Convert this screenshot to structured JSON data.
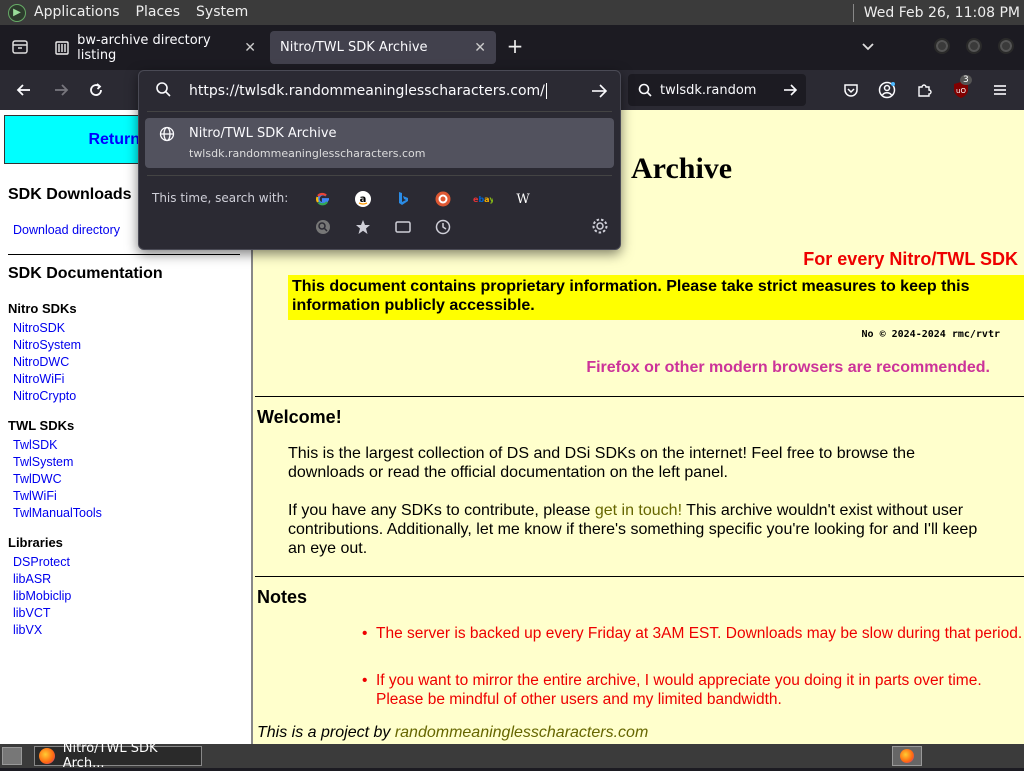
{
  "desktop": {
    "menu": [
      "Applications",
      "Places",
      "System"
    ],
    "clock": "Wed Feb 26, 11:08 PM"
  },
  "tabs": [
    {
      "title": "bw-archive directory listing",
      "icon": "folder-icon"
    },
    {
      "title": "Nitro/TWL SDK Archive",
      "icon": "none",
      "active": true
    }
  ],
  "urlbar": {
    "value": "https://twlsdk.randommeaninglesscharacters.com/",
    "suggestion_title": "Nitro/TWL SDK Archive",
    "suggestion_url": "twlsdk.randommeaninglesscharacters.com",
    "search_with_label": "This time, search with:",
    "engines": [
      "google",
      "amazon",
      "bing",
      "duckduckgo",
      "ebay",
      "wikipedia"
    ]
  },
  "searchbar": {
    "value": "twlsdk.random"
  },
  "extensions": {
    "ublock_count": "3"
  },
  "sidebar": {
    "return_label": "Return to",
    "downloads_heading": "SDK Downloads",
    "download_link": "Download directory",
    "docs_heading": "SDK Documentation",
    "groups": [
      {
        "heading": "Nitro SDKs",
        "items": [
          "NitroSDK",
          "NitroSystem",
          "NitroDWC",
          "NitroWiFi",
          "NitroCrypto"
        ]
      },
      {
        "heading": "TWL SDKs",
        "items": [
          "TwlSDK",
          "TwlSystem",
          "TwlDWC",
          "TwlWiFi",
          "TwlManualTools"
        ]
      },
      {
        "heading": "Libraries",
        "items": [
          "DSProtect",
          "libASR",
          "libMobiclip",
          "libVCT",
          "libVX"
        ]
      }
    ]
  },
  "main": {
    "title_visible": "Archive",
    "tagline": "For every Nitro/TWL SDK",
    "warning": "This document contains proprietary information. Please take strict measures to keep this information publicly accessible.",
    "copyright": "No © 2024-2024 rmc/rvtr",
    "recommend": "Firefox or other modern browsers are recommended.",
    "welcome_heading": "Welcome!",
    "welcome_p1": "This is the largest collection of DS and DSi SDKs on the internet! Feel free to browse the downloads or read the official documentation on the left panel.",
    "welcome_p2_pre": "If you have any SDKs to contribute, please ",
    "welcome_p2_link": "get in touch!",
    "welcome_p2_post": " This archive wouldn't exist without user contributions. Additionally, let me know if there's something specific you're looking for and I'll keep an eye out.",
    "notes_heading": "Notes",
    "notes": [
      "The server is backed up every Friday at 3AM EST. Downloads may be slow during that period.",
      "If you want to mirror the entire archive, I would appreciate you doing it in parts over time. Please be mindful of other users and my limited bandwidth."
    ],
    "footer_pre": "This is a project by ",
    "footer_link": "randommeaninglesscharacters.com"
  },
  "taskbar": {
    "task_label": "Nitro/TWL SDK Arch..."
  }
}
